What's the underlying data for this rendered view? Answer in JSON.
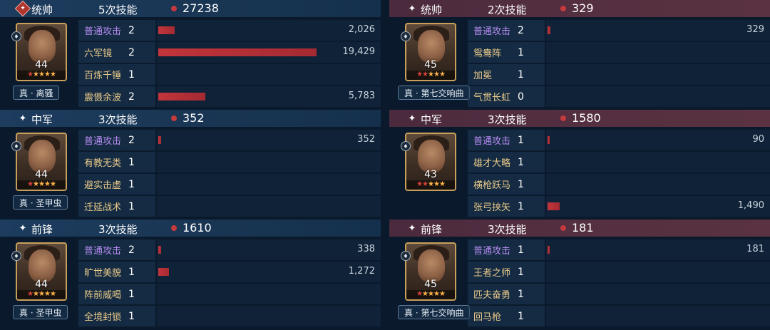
{
  "colors": {
    "bar": "#c2353b",
    "normal_skill": "#b68cf0",
    "skill": "#e9c98a",
    "frame": "#c9a05a"
  },
  "left": {
    "teams": [
      {
        "role_icon": "diamond-flag-icon",
        "role": "统帅",
        "count": "5次技能",
        "total": "27238",
        "level": "44",
        "stars": 5,
        "red_stars": 1,
        "tactic": "真 · 离骚",
        "skills": [
          {
            "name": "普通攻击",
            "cnt": "2",
            "value": 2026,
            "label": "2,026",
            "normal": true
          },
          {
            "name": "六军镜",
            "cnt": "2",
            "value": 19429,
            "label": "19,429",
            "normal": false
          },
          {
            "name": "百炼千锤",
            "cnt": "1",
            "value": 0,
            "label": "",
            "normal": false
          },
          {
            "name": "震慑余波",
            "cnt": "2",
            "value": 5783,
            "label": "5,783",
            "normal": false
          }
        ]
      },
      {
        "role_icon": "sparkle-icon",
        "role": "中军",
        "count": "3次技能",
        "total": "352",
        "level": "44",
        "stars": 5,
        "red_stars": 1,
        "tactic": "真 · 圣甲虫",
        "skills": [
          {
            "name": "普通攻击",
            "cnt": "2",
            "value": 352,
            "label": "352",
            "normal": true
          },
          {
            "name": "有教无类",
            "cnt": "1",
            "value": 0,
            "label": "",
            "normal": false
          },
          {
            "name": "避实击虚",
            "cnt": "1",
            "value": 0,
            "label": "",
            "normal": false
          },
          {
            "name": "迁延战术",
            "cnt": "1",
            "value": 0,
            "label": "",
            "normal": false
          }
        ]
      },
      {
        "role_icon": "sparkle-icon",
        "role": "前锋",
        "count": "3次技能",
        "total": "1610",
        "level": "44",
        "stars": 5,
        "red_stars": 1,
        "tactic": "真 · 圣甲虫",
        "skills": [
          {
            "name": "普通攻击",
            "cnt": "2",
            "value": 338,
            "label": "338",
            "normal": true
          },
          {
            "name": "旷世美貌",
            "cnt": "1",
            "value": 1272,
            "label": "1,272",
            "normal": false
          },
          {
            "name": "阵前威喝",
            "cnt": "1",
            "value": 0,
            "label": "",
            "normal": false
          },
          {
            "name": "全境封锁",
            "cnt": "1",
            "value": 0,
            "label": "",
            "normal": false
          }
        ]
      }
    ]
  },
  "right": {
    "teams": [
      {
        "role_icon": "sparkle-icon",
        "role": "统帅",
        "count": "2次技能",
        "total": "329",
        "level": "45",
        "stars": 5,
        "red_stars": 2,
        "tactic": "真 · 第七交响曲",
        "skills": [
          {
            "name": "普通攻击",
            "cnt": "2",
            "value": 329,
            "label": "329",
            "normal": true
          },
          {
            "name": "鸳鸯阵",
            "cnt": "1",
            "value": 0,
            "label": "",
            "normal": false
          },
          {
            "name": "加冕",
            "cnt": "1",
            "value": 0,
            "label": "",
            "normal": false
          },
          {
            "name": "气贯长虹",
            "cnt": "0",
            "value": 0,
            "label": "",
            "normal": false
          }
        ]
      },
      {
        "role_icon": "sparkle-icon",
        "role": "中军",
        "count": "3次技能",
        "total": "1580",
        "level": "43",
        "stars": 5,
        "red_stars": 2,
        "tactic": "",
        "skills": [
          {
            "name": "普通攻击",
            "cnt": "1",
            "value": 90,
            "label": "90",
            "normal": true
          },
          {
            "name": "雄才大略",
            "cnt": "1",
            "value": 0,
            "label": "",
            "normal": false
          },
          {
            "name": "横枪跃马",
            "cnt": "1",
            "value": 0,
            "label": "",
            "normal": false
          },
          {
            "name": "张弓挟矢",
            "cnt": "1",
            "value": 1490,
            "label": "1,490",
            "normal": false
          }
        ]
      },
      {
        "role_icon": "sparkle-icon",
        "role": "前锋",
        "count": "3次技能",
        "total": "181",
        "level": "45",
        "stars": 5,
        "red_stars": 1,
        "tactic": "真 · 第七交响曲",
        "skills": [
          {
            "name": "普通攻击",
            "cnt": "1",
            "value": 181,
            "label": "181",
            "normal": true
          },
          {
            "name": "王者之师",
            "cnt": "1",
            "value": 0,
            "label": "",
            "normal": false
          },
          {
            "name": "匹夫奋勇",
            "cnt": "1",
            "value": 0,
            "label": "",
            "normal": false
          },
          {
            "name": "回马枪",
            "cnt": "1",
            "value": 0,
            "label": "",
            "normal": false
          }
        ]
      }
    ]
  },
  "max_value": 19429
}
